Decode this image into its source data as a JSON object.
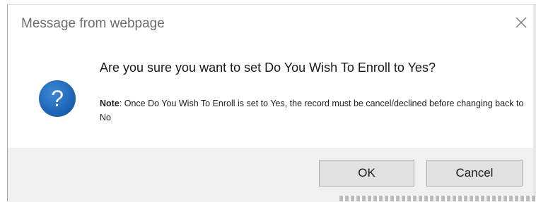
{
  "dialog": {
    "title": "Message from webpage",
    "close_icon": "close-icon",
    "question_icon": "question-mark-icon",
    "question_glyph": "?",
    "heading": "Are you sure you want to set Do You Wish To Enroll to Yes?",
    "note_label": "Note",
    "note_text": ": Once Do You Wish To Enroll is set to Yes, the record must be cancel/declined before changing back to No",
    "ok_label": "OK",
    "cancel_label": "Cancel"
  },
  "colors": {
    "icon_blue": "#1f6fc1",
    "footer_bg": "#f0f0f0",
    "button_bg": "#e1e1e1"
  }
}
